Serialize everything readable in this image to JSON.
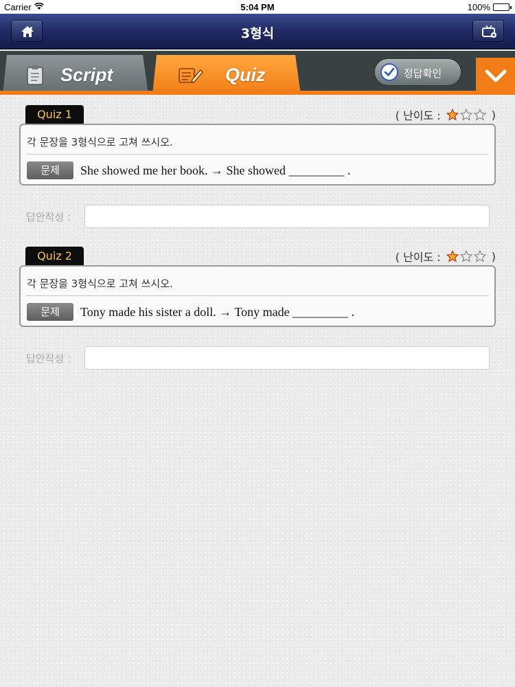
{
  "status_bar": {
    "carrier": "Carrier",
    "time": "5:04 PM",
    "battery": "100%"
  },
  "header": {
    "title": "3형식",
    "home_icon": "home-icon",
    "right_icon": "tv-settings-icon"
  },
  "tabs": [
    {
      "label": "Script",
      "icon": "clipboard-icon",
      "active": false
    },
    {
      "label": "Quiz",
      "icon": "pencil-paper-icon",
      "active": true
    }
  ],
  "check_answer_button": {
    "label": "정답확인",
    "icon": "checkmark-icon"
  },
  "dropdown_icon": "chevron-down-icon",
  "colors": {
    "accent": "#f27d16",
    "nav": "#202b66",
    "badge_text": "#f4c64c",
    "star": "#f0a81c"
  },
  "quizzes": [
    {
      "badge": "Quiz 1",
      "difficulty_label": "( 난이도 :",
      "difficulty_close": ")",
      "difficulty_stars": 1,
      "difficulty_max": 3,
      "instruction": "각 문장을 3형식으로 고쳐 쓰시오.",
      "problem_tag": "문제",
      "problem_text": "She showed me her book. → She showed _________ .",
      "answer_label": "답안작성 :",
      "answer_value": "",
      "answer_placeholder": ""
    },
    {
      "badge": "Quiz 2",
      "difficulty_label": "( 난이도 :",
      "difficulty_close": ")",
      "difficulty_stars": 1,
      "difficulty_max": 3,
      "instruction": "각 문장을 3형식으로 고쳐 쓰시오.",
      "problem_tag": "문제",
      "problem_text": "Tony made his sister a doll. → Tony made _________ .",
      "answer_label": "답안작성 :",
      "answer_value": "",
      "answer_placeholder": ""
    }
  ]
}
